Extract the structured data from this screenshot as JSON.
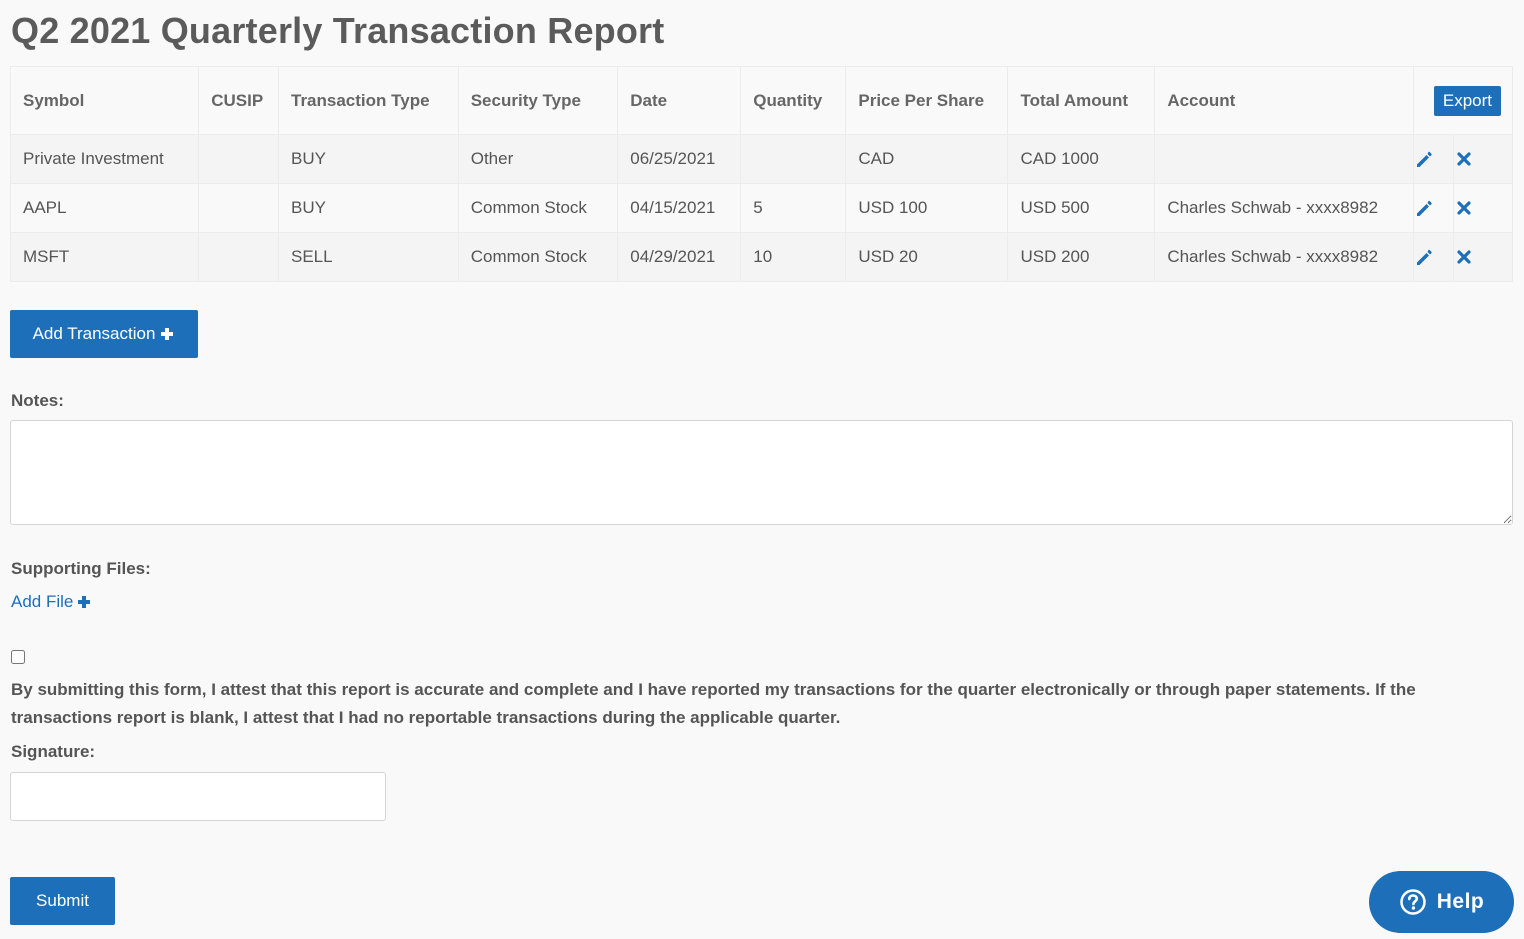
{
  "page": {
    "title": "Q2 2021 Quarterly Transaction Report"
  },
  "table": {
    "columns": [
      "Symbol",
      "CUSIP",
      "Transaction Type",
      "Security Type",
      "Date",
      "Quantity",
      "Price Per Share",
      "Total Amount",
      "Account"
    ],
    "export_label": "Export",
    "rows": [
      {
        "symbol": "Private Investment",
        "cusip": "",
        "transaction_type": "BUY",
        "security_type": "Other",
        "date": "06/25/2021",
        "quantity": "",
        "price_per_share": "CAD",
        "total_amount": "CAD 1000",
        "account": ""
      },
      {
        "symbol": "AAPL",
        "cusip": "",
        "transaction_type": "BUY",
        "security_type": "Common Stock",
        "date": "04/15/2021",
        "quantity": "5",
        "price_per_share": "USD 100",
        "total_amount": "USD 500",
        "account": "Charles Schwab - xxxx8982"
      },
      {
        "symbol": "MSFT",
        "cusip": "",
        "transaction_type": "SELL",
        "security_type": "Common Stock",
        "date": "04/29/2021",
        "quantity": "10",
        "price_per_share": "USD 20",
        "total_amount": "USD 200",
        "account": "Charles Schwab - xxxx8982"
      }
    ]
  },
  "actions": {
    "add_transaction_label": "Add Transaction"
  },
  "notes": {
    "label": "Notes:",
    "value": "",
    "placeholder": ""
  },
  "files": {
    "label": "Supporting Files:",
    "add_label": "Add File"
  },
  "attestation": {
    "checked": false,
    "text": "By submitting this form, I attest that this report is accurate and complete and I have reported my transactions for the quarter electronically or through paper statements. If the transactions report is blank, I attest that I had no reportable transactions during the applicable quarter."
  },
  "signature": {
    "label": "Signature:",
    "value": "",
    "placeholder": ""
  },
  "submit_label": "Submit",
  "help_label": "Help",
  "colors": {
    "accent": "#1e6fba",
    "text": "#555555",
    "background": "#f9f9f9"
  },
  "icons": {
    "edit": "pencil-icon",
    "delete": "close-icon",
    "add": "plus-icon",
    "help": "question-circle-icon"
  }
}
